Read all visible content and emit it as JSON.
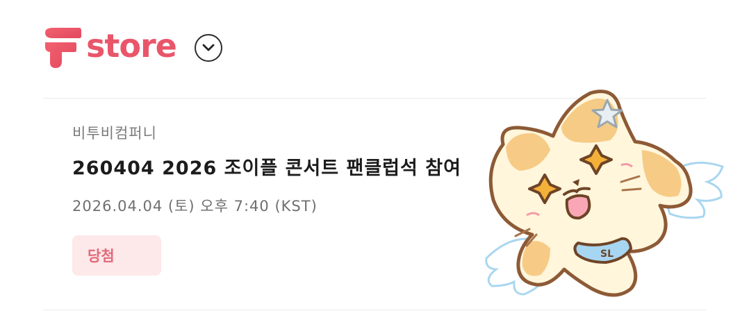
{
  "header": {
    "logo_text": "store",
    "brand_color": "#e9566a",
    "dropdown_icon": "chevron-down-icon"
  },
  "ticket": {
    "vendor": "비투비컴퍼니",
    "title": "260404 2026 조이플 콘서트 팬클럽석 참여",
    "datetime": "2026.04.04 (토) 오후 7:40 (KST)",
    "status": "당첨",
    "status_color": "#e26a79",
    "status_bg": "#fde8ea"
  },
  "sticker": {
    "icon": "winged-cat-sticker",
    "scarf_text": "SL"
  }
}
